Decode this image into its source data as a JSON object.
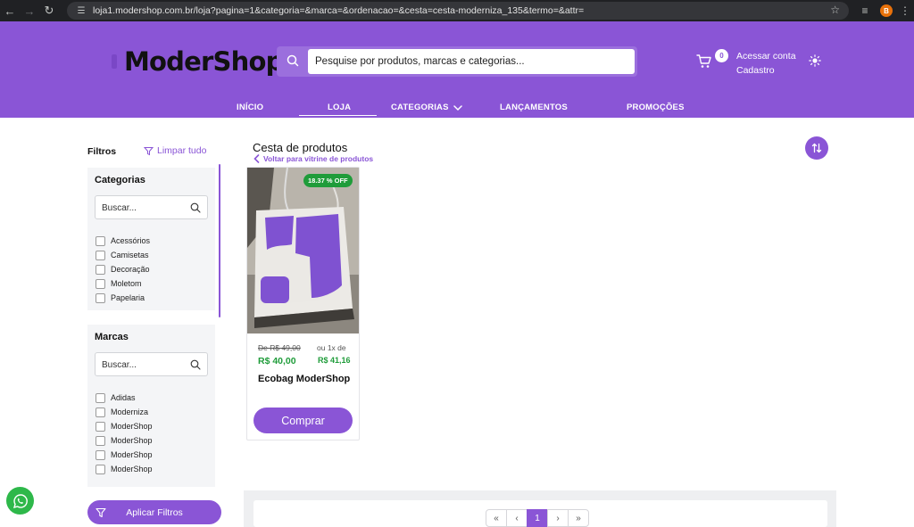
{
  "browser": {
    "url": "loja1.modershop.com.br/loja?pagina=1&categoria=&marca=&ordenacao=&cesta=cesta-moderniza_135&termo=&attr=",
    "profile_initial": "B",
    "icons": [
      "back-icon",
      "forward-icon",
      "reload-icon",
      "site-info-icon",
      "star-icon",
      "media-icon",
      "menu-icon"
    ]
  },
  "header": {
    "logo": "ModerShop",
    "search_placeholder": "Pesquise por produtos, marcas e categorias...",
    "cart_count": "0",
    "account_line1": "Acessar conta",
    "account_line2": "Cadastro",
    "nav": [
      {
        "label": "INÍCIO"
      },
      {
        "label": "LOJA"
      },
      {
        "label": "CATEGORIAS"
      },
      {
        "label": "LANÇAMENTOS"
      },
      {
        "label": "PROMOÇÕES"
      }
    ],
    "active_nav": "LOJA"
  },
  "sidebar": {
    "title": "Filtros",
    "clear_label": "Limpar tudo",
    "categories": {
      "title": "Categorias",
      "search_placeholder": "Buscar...",
      "items": [
        "Acessórios",
        "Camisetas",
        "Decoração",
        "Moletom",
        "Papelaria"
      ]
    },
    "brands": {
      "title": "Marcas",
      "search_placeholder": "Buscar...",
      "items": [
        "Adidas",
        "Moderniza",
        "ModerShop",
        "ModerShop",
        "ModerShop",
        "ModerShop"
      ]
    },
    "apply_label": "Aplicar Filtros"
  },
  "main": {
    "title": "Cesta de produtos",
    "back_label": "Voltar para vitrine de produtos",
    "products": [
      {
        "badge": "18.37 % OFF",
        "old_price": "De R$ 49,00",
        "installment_label": "ou 1x de",
        "price": "R$ 40,00",
        "installment_value": "R$ 41,16",
        "name": "Ecobag ModerShop",
        "buy_label": "Comprar"
      }
    ],
    "pagination": {
      "first": "«",
      "prev": "‹",
      "current": "1",
      "next": "›",
      "last": "»"
    }
  },
  "colors": {
    "brand": "#8a55d6",
    "price_green": "#1f9c3a",
    "whatsapp": "#2eb84a"
  }
}
